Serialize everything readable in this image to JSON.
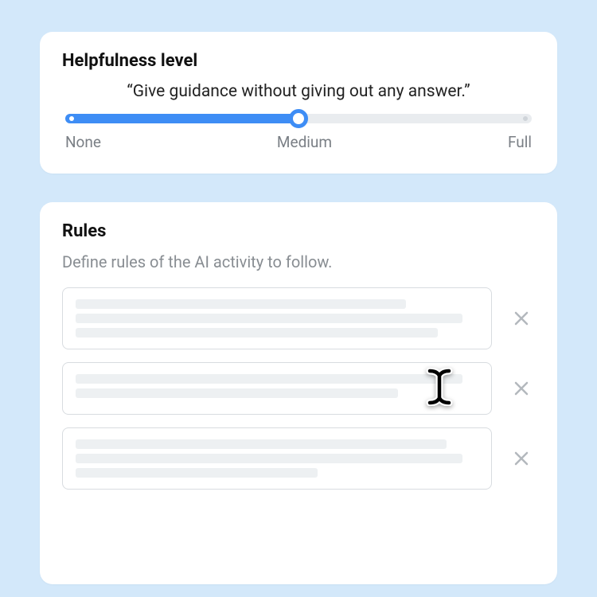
{
  "helpfulness": {
    "title": "Helpfulness level",
    "quote": "“Give guidance without giving out any answer.”",
    "labels": {
      "none": "None",
      "medium": "Medium",
      "full": "Full"
    },
    "value_percent": 50
  },
  "rules": {
    "title": "Rules",
    "subtitle": "Define rules of the AI activity to follow.",
    "items": [
      {
        "lines": [
          82,
          96,
          90
        ]
      },
      {
        "lines": [
          96,
          80
        ]
      },
      {
        "lines": [
          92,
          96,
          60
        ]
      }
    ]
  }
}
